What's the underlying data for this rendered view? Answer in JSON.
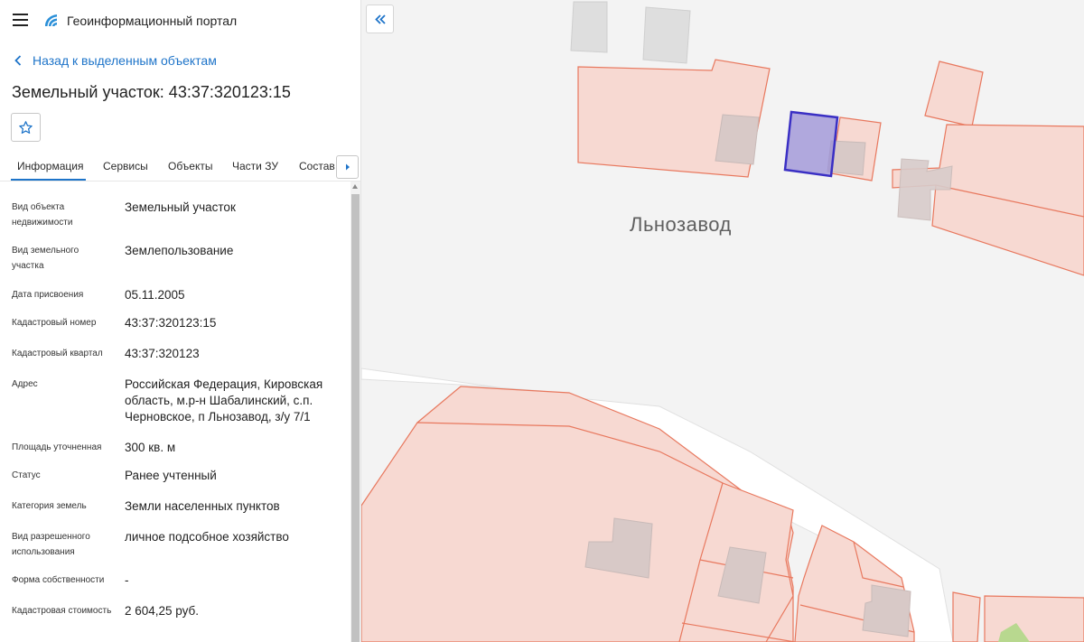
{
  "header": {
    "app_title": "Геоинформационный портал",
    "menu_icon": "hamburger-menu-icon",
    "logo_icon": "portal-logo-icon"
  },
  "navigation": {
    "back_label": "Назад к выделенным объектам"
  },
  "page": {
    "title": "Земельный участок: 43:37:320123:15"
  },
  "tabs": [
    {
      "label": "Информация",
      "active": true
    },
    {
      "label": "Сервисы",
      "active": false
    },
    {
      "label": "Объекты",
      "active": false
    },
    {
      "label": "Части ЗУ",
      "active": false
    },
    {
      "label": "Состав",
      "active": false
    }
  ],
  "info": [
    {
      "label": "Вид объекта недвижимости",
      "value": "Земельный участок"
    },
    {
      "label": "Вид земельного участка",
      "value": "Землепользование"
    },
    {
      "label": "Дата присвоения",
      "value": "05.11.2005"
    },
    {
      "label": "Кадастровый номер",
      "value": "43:37:320123:15"
    },
    {
      "label": "Кадастровый квартал",
      "value": "43:37:320123"
    },
    {
      "label": "Адрес",
      "value": "Российская Федерация, Кировская область, м.р-н Шабалинский, с.п. Черновское, п Льнозавод, з/у 7/1"
    },
    {
      "label": "Площадь уточненная",
      "value": "300 кв. м"
    },
    {
      "label": "Статус",
      "value": "Ранее учтенный"
    },
    {
      "label": "Категория земель",
      "value": "Земли населенных пунктов"
    },
    {
      "label": "Вид разрешенного использования",
      "value": "личное подсобное хозяйство"
    },
    {
      "label": "Форма собственности",
      "value": "-"
    },
    {
      "label": "Кадастровая стоимость",
      "value": "2 604,25 руб."
    }
  ],
  "map": {
    "place_label": "Льнозавод",
    "colors": {
      "background": "#f3f3f3",
      "parcel_fill": "#f7d9d2",
      "parcel_stroke": "#e8785e",
      "building_fill": "#cccccc",
      "selected_fill": "#9a8fd6",
      "selected_stroke": "#3a2fc4",
      "road": "#ffffff",
      "green": "#b8d88f"
    }
  },
  "colors": {
    "accent": "#1e74c9",
    "text": "#222222"
  }
}
